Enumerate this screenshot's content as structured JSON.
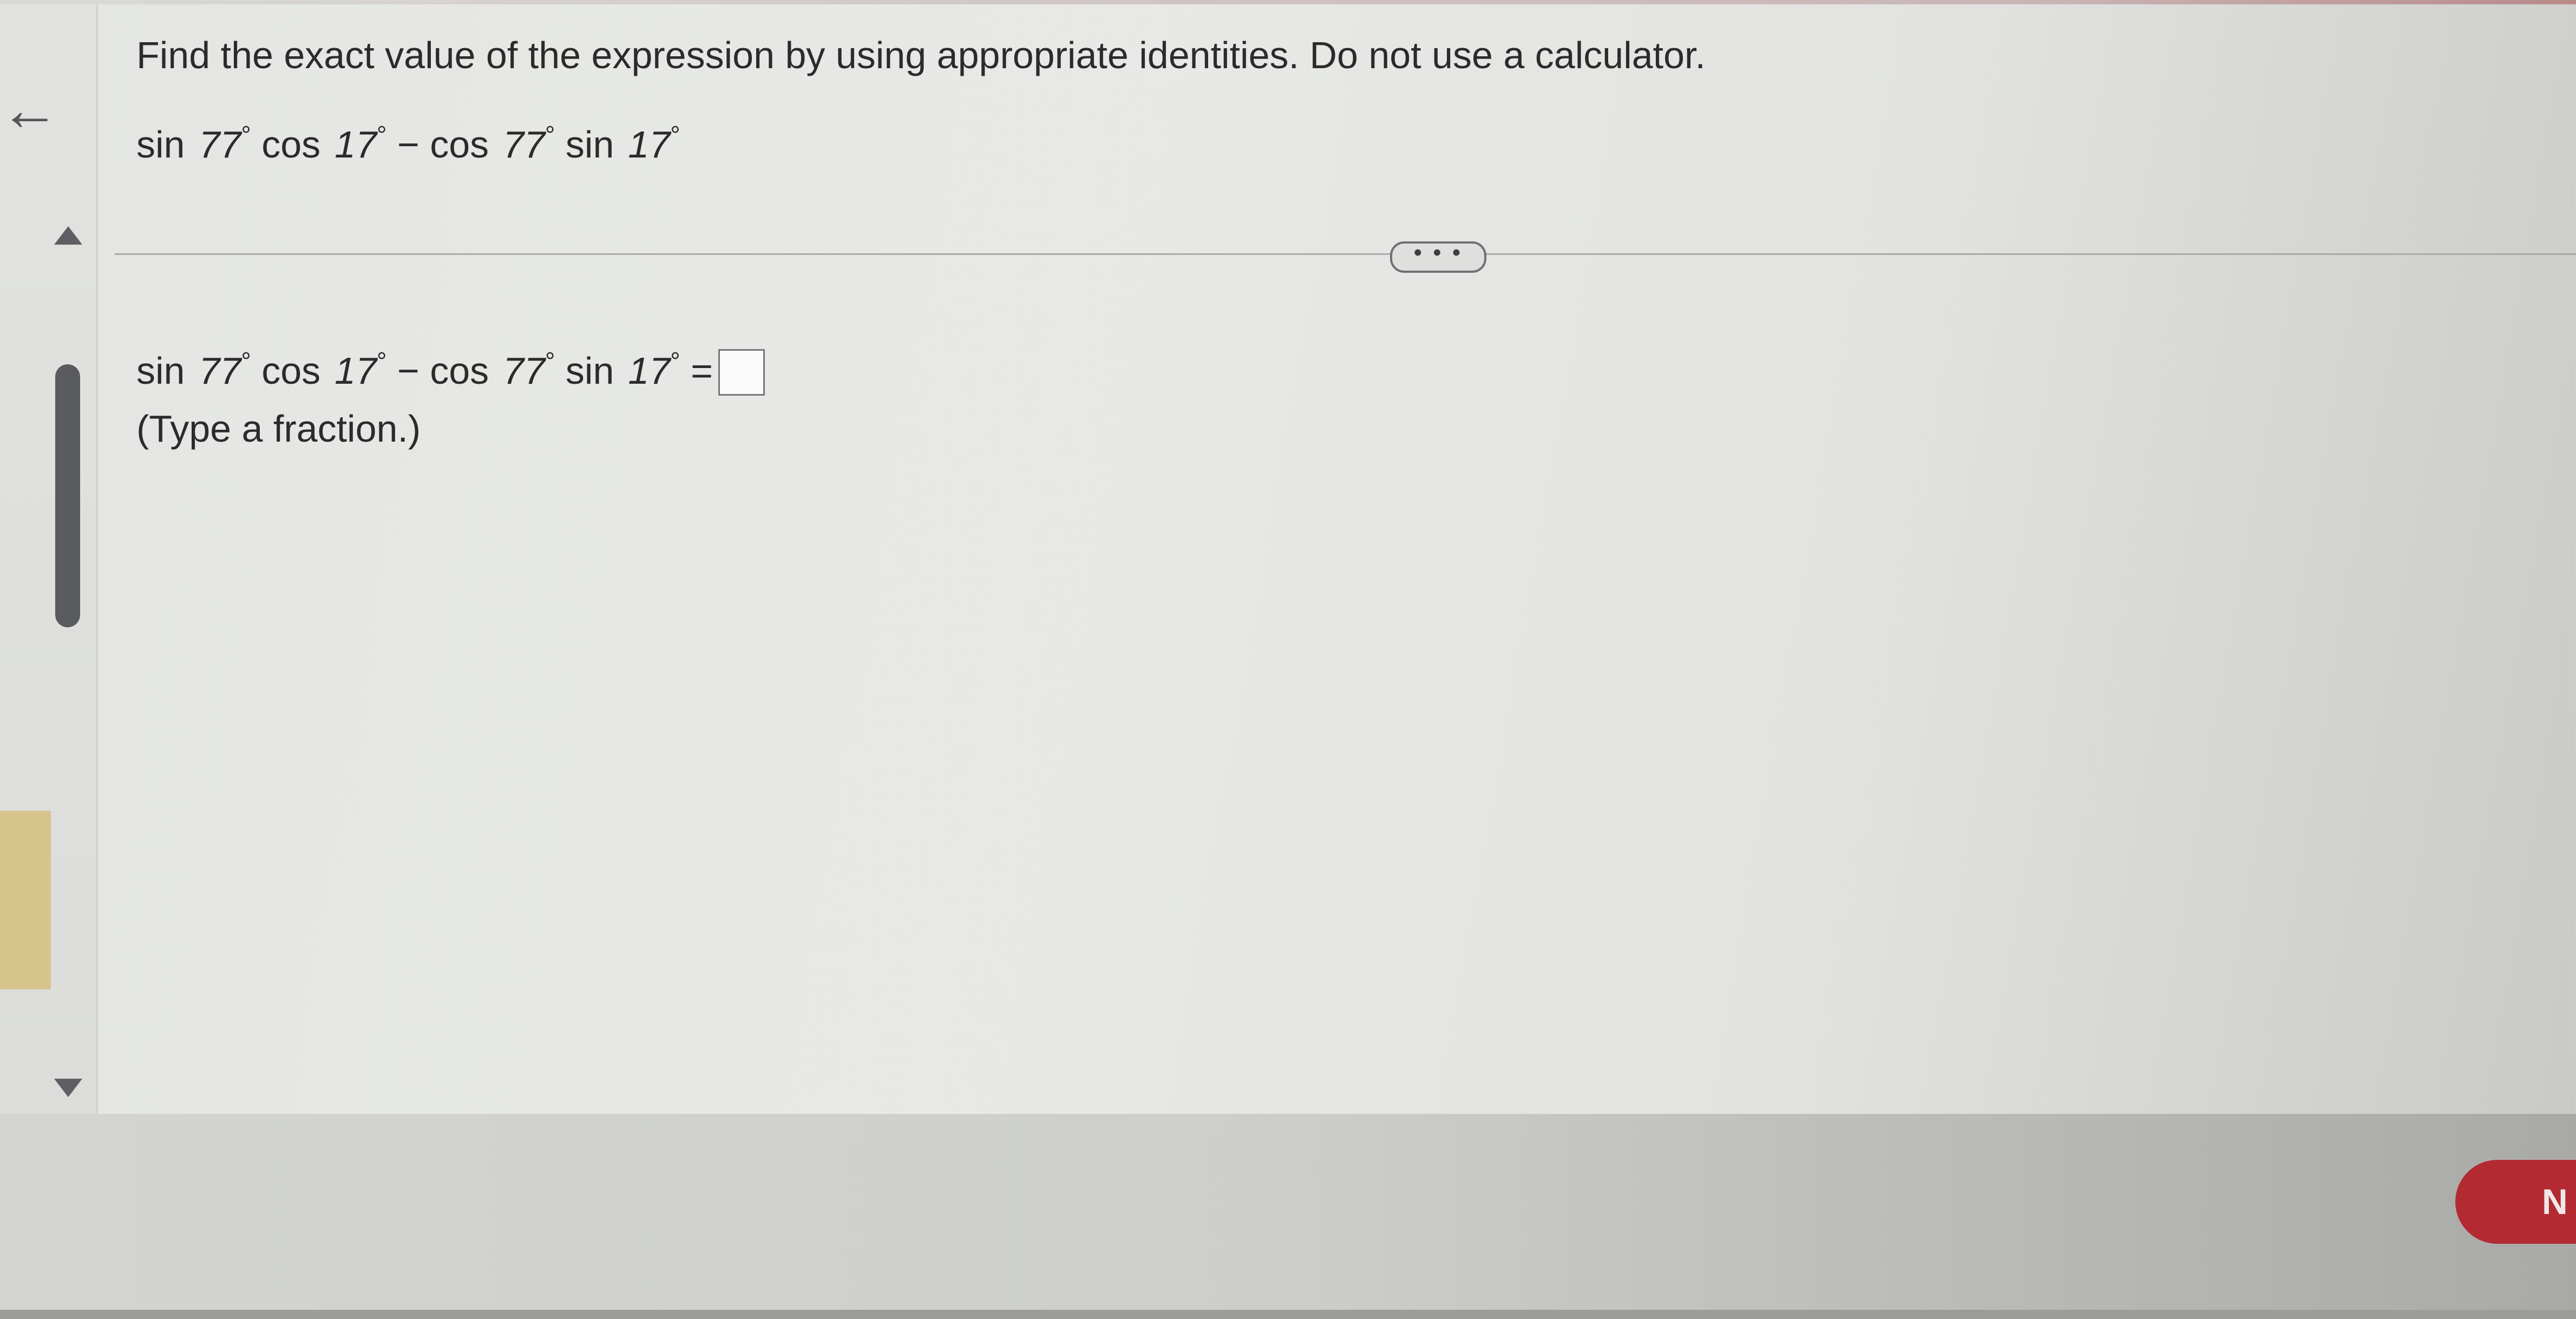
{
  "header": {
    "back_icon": "back-arrow-icon",
    "instruction": "Find the exact value of the expression by using appropriate identities. Do not use a calculator."
  },
  "expression": {
    "fn1": "sin",
    "num1": "77",
    "fn2": "cos",
    "num2": "17",
    "minus": "−",
    "fn3": "cos",
    "num3": "77",
    "fn4": "sin",
    "num4": "17",
    "degree": "°",
    "equals": "="
  },
  "divider": {
    "more_label": "• • •"
  },
  "answer": {
    "value": "",
    "hint": "(Type a fraction.)"
  },
  "footer": {
    "next_label": "N"
  },
  "colors": {
    "accent_button": "#b32a33",
    "scroll_thumb": "#5a5b5e",
    "side_tab": "#d7c48d"
  }
}
